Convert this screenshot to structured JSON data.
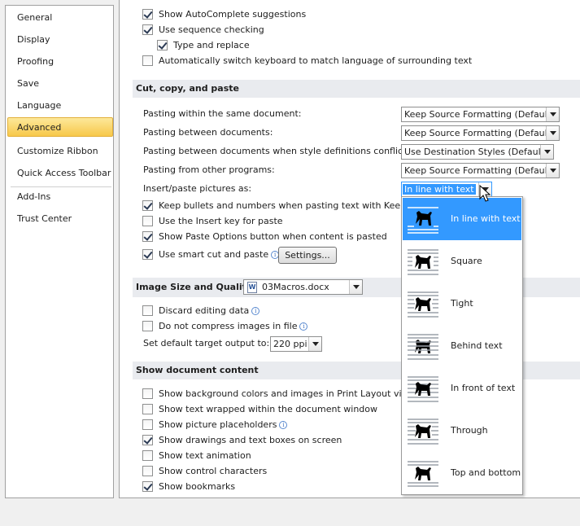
{
  "sidebar": {
    "items": [
      {
        "label": "General"
      },
      {
        "label": "Display"
      },
      {
        "label": "Proofing"
      },
      {
        "label": "Save"
      },
      {
        "label": "Language"
      },
      {
        "label": "Advanced"
      },
      {
        "label": "Customize Ribbon"
      },
      {
        "label": "Quick Access Toolbar"
      },
      {
        "label": "Add-Ins"
      },
      {
        "label": "Trust Center"
      }
    ],
    "selected": "Advanced"
  },
  "editing": {
    "autocomplete": {
      "label": "Show AutoComplete suggestions",
      "checked": true
    },
    "sequence": {
      "label": "Use sequence checking",
      "checked": true
    },
    "type_replace": {
      "label": "Type and replace",
      "checked": true
    },
    "auto_keyboard": {
      "label": "Automatically switch keyboard to match language of surrounding text",
      "checked": false
    }
  },
  "cut_copy_paste": {
    "header": "Cut, copy, and paste",
    "within_doc": {
      "label": "Pasting within the same document:",
      "value": "Keep Source Formatting (Default)"
    },
    "between_docs": {
      "label": "Pasting between documents:",
      "value": "Keep Source Formatting (Default)"
    },
    "between_conflict": {
      "label": "Pasting between documents when style definitions conflict:",
      "value": "Use Destination Styles (Default)"
    },
    "other_programs": {
      "label": "Pasting from other programs:",
      "value": "Keep Source Formatting (Default)"
    },
    "insert_pictures": {
      "label": "Insert/paste pictures as:",
      "value": "In line with text"
    },
    "keep_bullets": {
      "label": "Keep bullets and numbers when pasting text with Keep Te",
      "checked": true
    },
    "insert_key": {
      "label": "Use the Insert key for paste",
      "checked": false
    },
    "paste_options": {
      "label": "Show Paste Options button when content is pasted",
      "checked": true
    },
    "smart_cut": {
      "label": "Use smart cut and paste",
      "checked": true
    },
    "settings_button": "Settings..."
  },
  "image_size": {
    "header": "Image Size and Quality",
    "document": "03Macros.docx",
    "doc_icon": "W",
    "discard": {
      "label": "Discard editing data",
      "checked": false
    },
    "no_compress": {
      "label": "Do not compress images in file",
      "checked": false
    },
    "target_output": {
      "label": "Set default target output to:",
      "value": "220 ppi"
    }
  },
  "show_content": {
    "header": "Show document content",
    "items": [
      {
        "label": "Show background colors and images in Print Layout view",
        "checked": false
      },
      {
        "label": "Show text wrapped within the document window",
        "checked": false
      },
      {
        "label": "Show picture placeholders",
        "checked": false
      },
      {
        "label": "Show drawings and text boxes on screen",
        "checked": true
      },
      {
        "label": "Show text animation",
        "checked": false
      },
      {
        "label": "Show control characters",
        "checked": false
      },
      {
        "label": "Show bookmarks",
        "checked": true
      }
    ]
  },
  "dropdown": {
    "options": [
      {
        "label": "In line with text",
        "icon": "inline-icon",
        "selected": true
      },
      {
        "label": "Square",
        "icon": "square-icon",
        "selected": false
      },
      {
        "label": "Tight",
        "icon": "tight-icon",
        "selected": false
      },
      {
        "label": "Behind text",
        "icon": "behind-icon",
        "selected": false
      },
      {
        "label": "In front of text",
        "icon": "front-icon",
        "selected": false
      },
      {
        "label": "Through",
        "icon": "through-icon",
        "selected": false
      },
      {
        "label": "Top and bottom",
        "icon": "top-bottom-icon",
        "selected": false
      }
    ]
  },
  "colors": {
    "accent": "#3399ff",
    "selected_nav": "#f7c84a",
    "section_bg": "#e9ebef"
  }
}
